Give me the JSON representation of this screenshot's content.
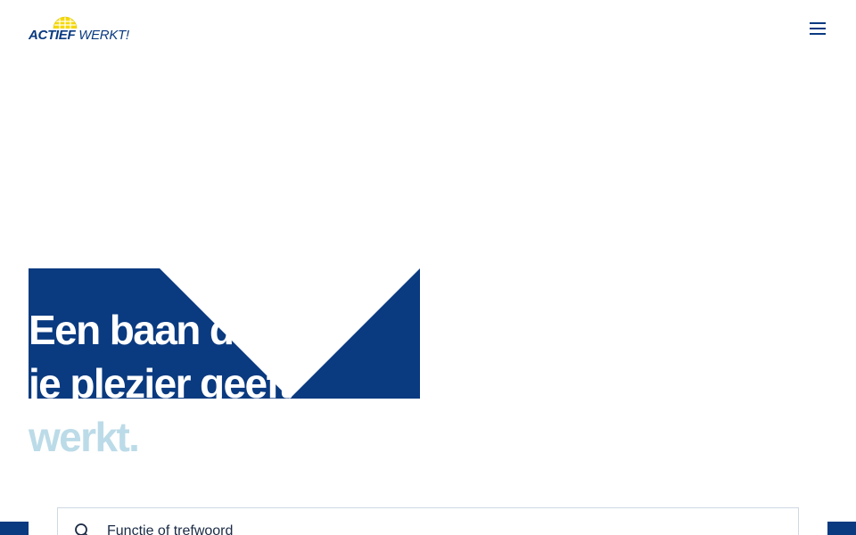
{
  "header": {
    "logo": {
      "word_bold": "ACTIEF",
      "word_light": " WERKT!"
    },
    "menu_icon": "hamburger-menu-icon"
  },
  "hero": {
    "headline": {
      "line1": "Een baan die",
      "line2": "je plezier geeft",
      "line3": "werkt."
    }
  },
  "search": {
    "placeholder": "Functie of trefwoord",
    "icon": "search-icon"
  },
  "colors": {
    "brand_blue": "#0a3a80",
    "accent_light_blue": "#bcdbe8",
    "logo_yellow": "#f5d800"
  }
}
